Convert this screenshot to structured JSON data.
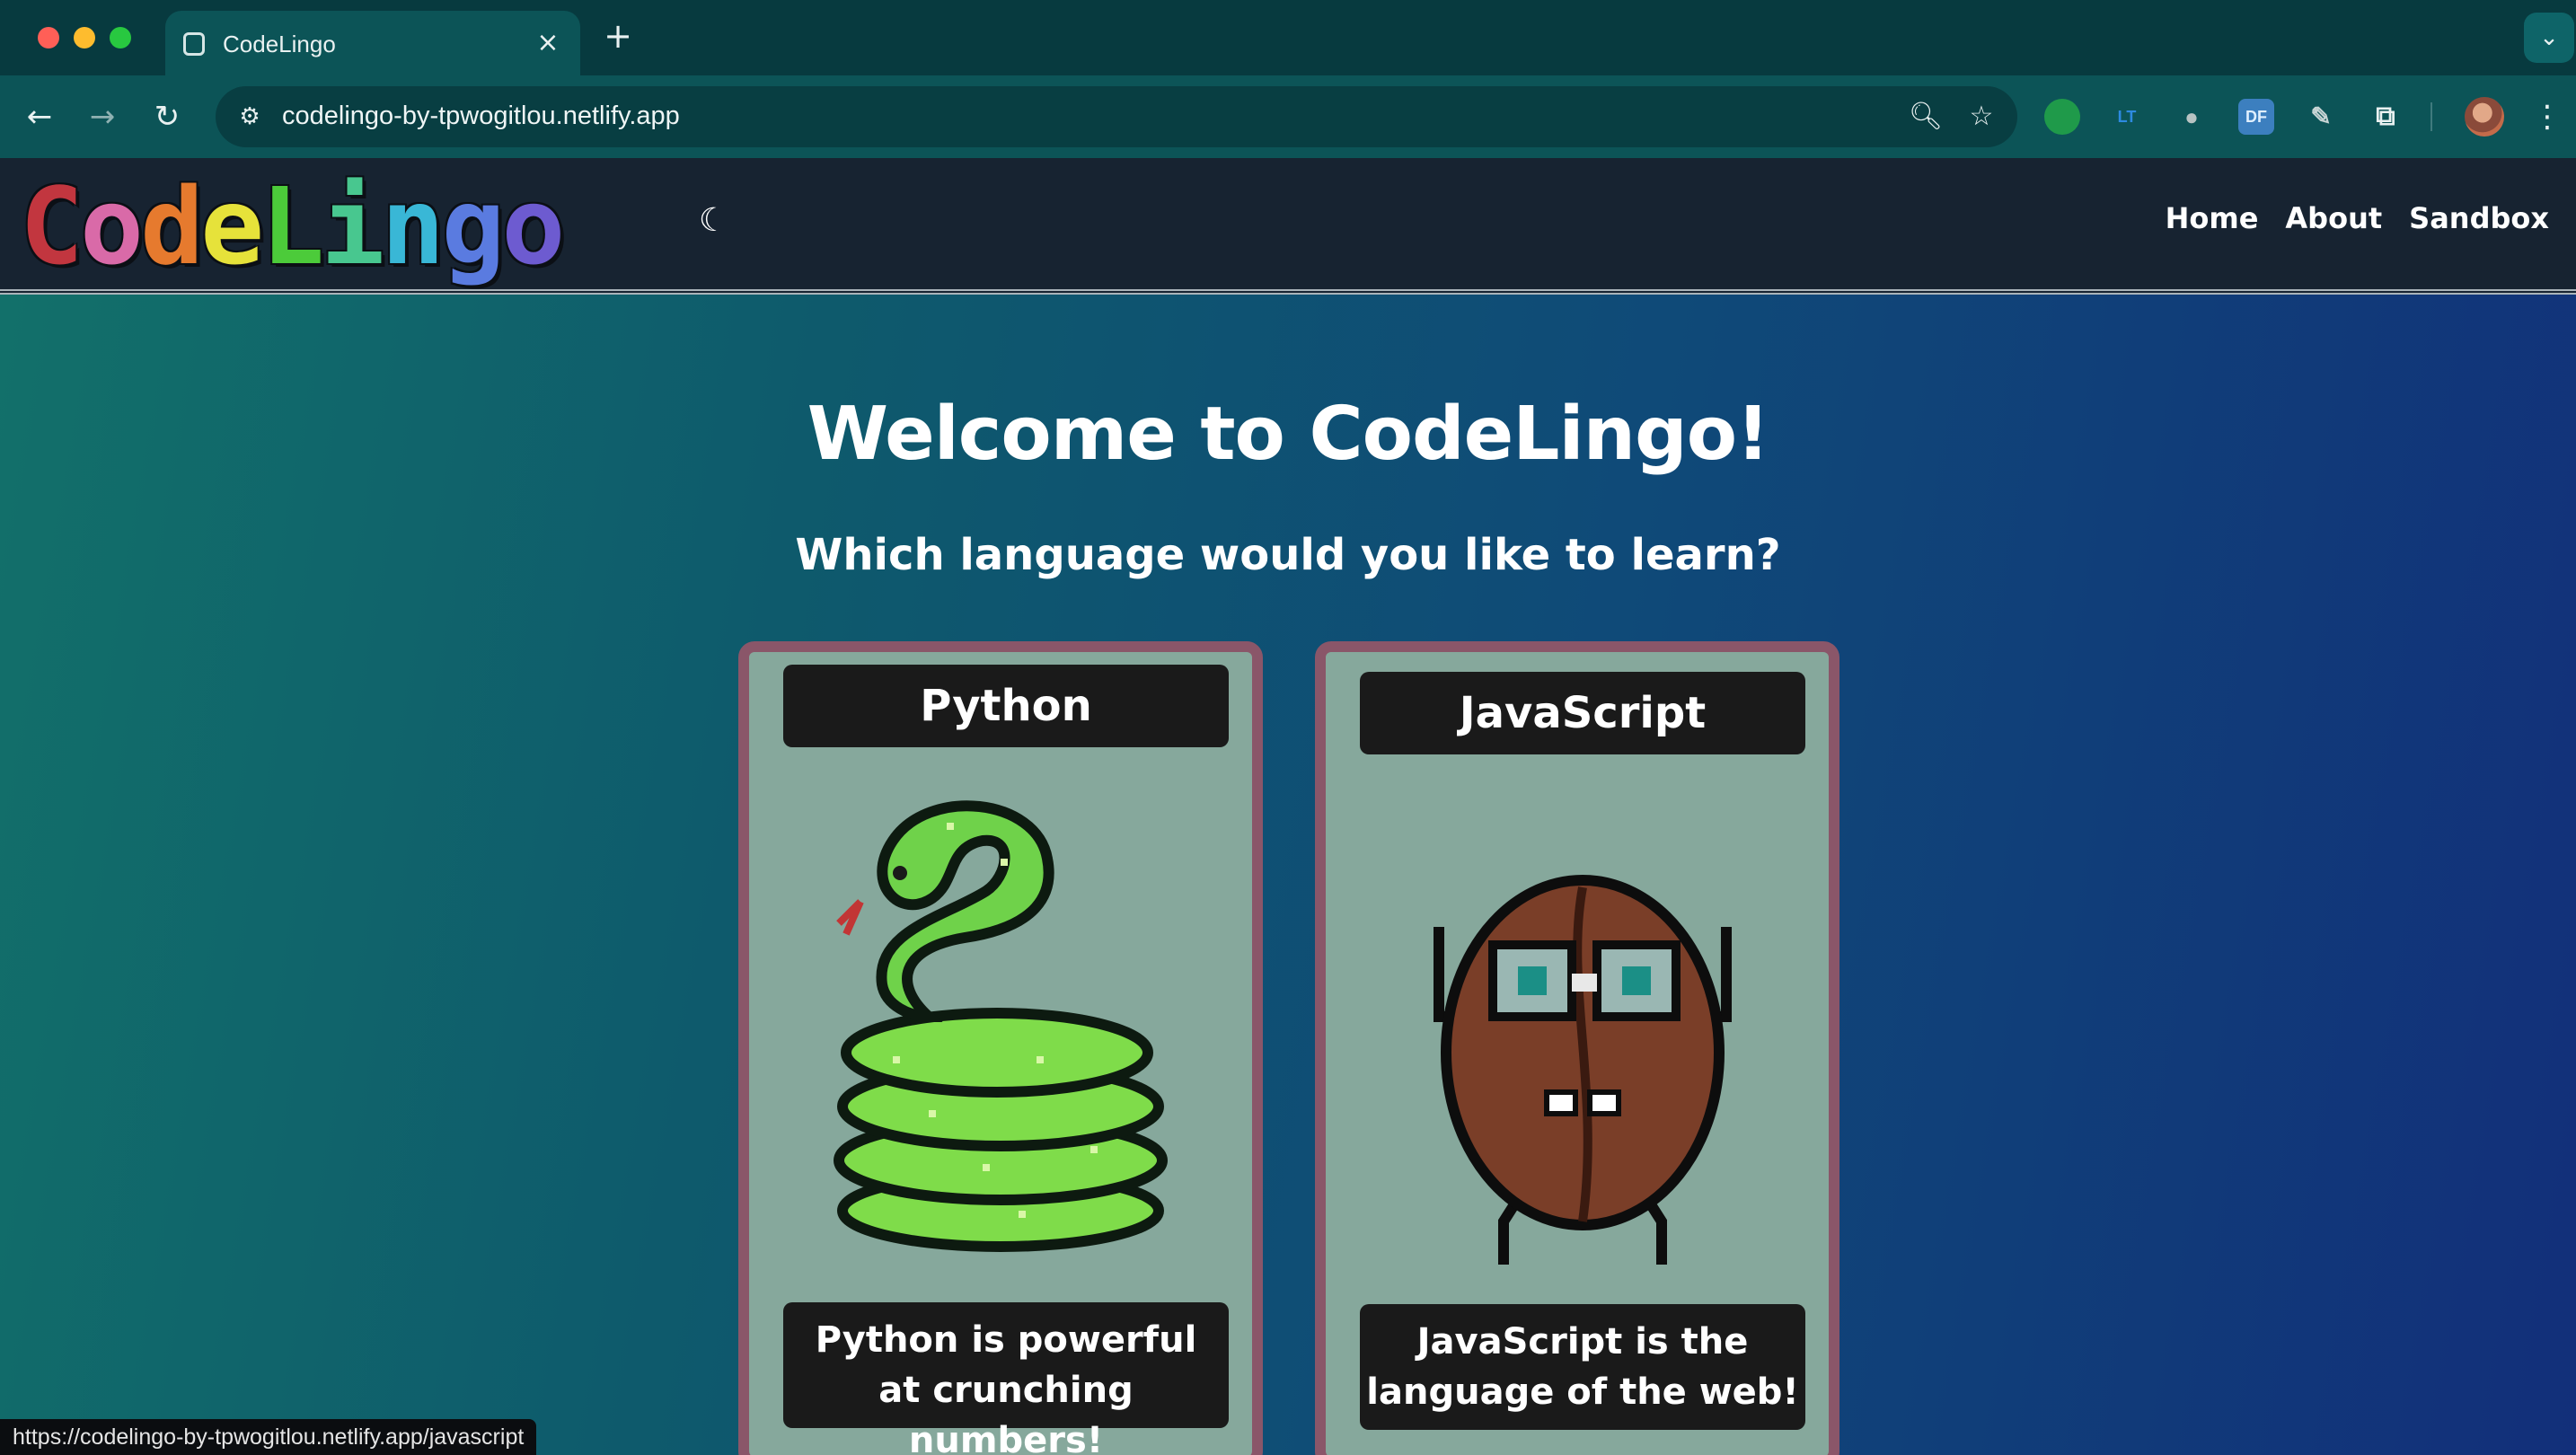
{
  "browser": {
    "tab_title": "CodeLingo",
    "tab_close": "×",
    "new_tab": "+",
    "url": "codelingo-by-tpwogitlou.netlify.app",
    "extensions": [
      "lastpass-like-icon",
      "LT",
      "mic",
      "DF",
      "pen",
      "puzzle"
    ],
    "ext_lt": "LT",
    "ext_df": "DF",
    "status_url": "https://codelingo-by-tpwogitlou.netlify.app/javascript"
  },
  "header": {
    "logo_letters": [
      "C",
      "o",
      "d",
      "e",
      "L",
      "i",
      "n",
      "g",
      "o"
    ],
    "logo_colors": [
      "#c2363f",
      "#d96aa8",
      "#e67a2e",
      "#e6e23a",
      "#4ccb3a",
      "#48c78f",
      "#39b7d6",
      "#5a7be0",
      "#6d5bd0"
    ],
    "nav": {
      "home": "Home",
      "about": "About",
      "sandbox": "Sandbox"
    }
  },
  "main": {
    "welcome": "Welcome to CodeLingo!",
    "subtitle": "Which language would you like to learn?",
    "cards": {
      "python": {
        "title": "Python",
        "desc_line1": "Python is powerful",
        "desc_line2": "at crunching numbers!"
      },
      "javascript": {
        "title": "JavaScript",
        "desc_line1": "JavaScript is the",
        "desc_line2": "language of the web!"
      }
    }
  },
  "colors": {
    "card_bg": "#86a89c",
    "card_border": "#8a5669",
    "header_bg": "#172331"
  }
}
